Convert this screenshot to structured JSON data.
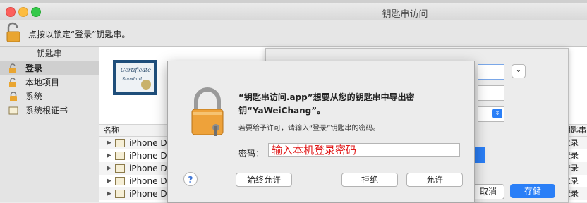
{
  "window": {
    "title": "钥匙串访问"
  },
  "toolbar": {
    "lock_hint": "点按以锁定“登录”钥匙串。",
    "lock_icon": "lock-open-icon"
  },
  "sidebar": {
    "header": "钥匙串",
    "items": [
      {
        "label": "登录",
        "icon": "lock-open-icon",
        "selected": true
      },
      {
        "label": "本地项目",
        "icon": "lock-open-icon",
        "selected": false
      },
      {
        "label": "系统",
        "icon": "lock-icon",
        "selected": false
      },
      {
        "label": "系统根证书",
        "icon": "certificate-icon",
        "selected": false
      }
    ]
  },
  "list": {
    "column_name": "名称",
    "column_keychain": "钥匙串",
    "rows": [
      {
        "name": "iPhone Dis",
        "keychain": "登录"
      },
      {
        "name": "iPhone Dis",
        "keychain": "登录"
      },
      {
        "name": "iPhone Dis",
        "keychain": "登录"
      },
      {
        "name": "iPhone Dis",
        "keychain": "登录"
      },
      {
        "name": "iPhone Distr",
        "keychain": "登录"
      }
    ]
  },
  "save_sheet": {
    "cancel_label": "取消",
    "save_label": "存储"
  },
  "dialog": {
    "title": "“钥匙串访问.app”想要从您的钥匙串中导出密钥“YaWeiChang”。",
    "subtitle": "若要给予许可，请输入“登录”钥匙串的密码。",
    "password_label": "密码：",
    "password_placeholder": "输入本机登录密码",
    "help_label": "?",
    "always_allow_label": "始终允许",
    "deny_label": "拒绝",
    "allow_label": "允许"
  },
  "colors": {
    "accent": "#2a7ff7",
    "placeholder_red": "#e01919"
  }
}
